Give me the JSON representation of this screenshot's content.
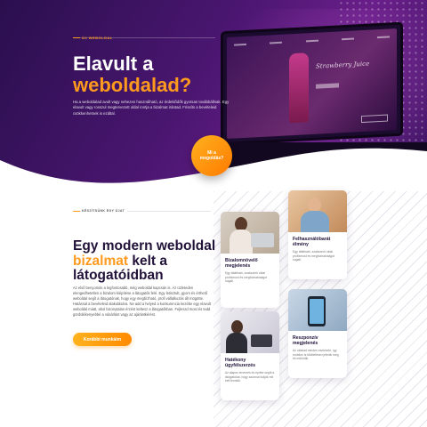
{
  "hero": {
    "eyebrow": "ÚJ WEBOLDAL",
    "title_line1": "Elavult a",
    "title_line2": "weboldalad?",
    "text": "Ha a weboldalad avult vagy nehezen használható, az érdeklődők gyorsan továbbállnak. Egy elavult vagy rosszul megtervezett oldal rontja a bizalmat irántad. Frissíts a bevételeid csökkenhetnek is ezáltal.",
    "cta": "Mi a megoldás?"
  },
  "laptop_screen": {
    "headline": "Strawberry Juice"
  },
  "section2": {
    "eyebrow": "KÉSZÍTSÜNK EGY ÚJAT",
    "title_part1": "Egy modern weboldal ",
    "title_accent": "bizalmat",
    "title_part2": " kelt a látogatóidban",
    "text": "Az első benyomás a legfontosabb, még weboldal kapcsán is. Az üzleteden elengedhetetlen a bizalom kiépítése a látogatók felé. Egy letisztult, gyors és érthető weboldal segít a látogatónak, hogy egy megbízható, profi vállalkozás áll mögötte. Hatással a bevételeid alakulására. Ne add a helyed a konkurencia kezébe egy elavult weboldal miatt, ahol bizonytalan érzést keltesz a látogatókban. Fejleszd most és tedd gördülékenyebbé a vásárlást vagy az ajánlatkérést.",
    "button": "Korábbi munkáim"
  },
  "cards": [
    {
      "title": "Bizalomnövelő megjelenés",
      "desc": "Egy átlátható, szakszerű oldal profizmust és megbízhatóságot sugall."
    },
    {
      "title": "Felhasználóbarát élmény",
      "desc": "Egy átlátható, szakszerű oldal profizmust és megbízhatóságot sugall."
    },
    {
      "title": "Hatékony ügyfélszerzés",
      "desc": "Az alapos tervezés és építés segíti a látogatókat, hogy azonnal tudják mit kell tenniük."
    },
    {
      "title": "Reszponzív megjelenés",
      "desc": "Az oldalad minden eszközön, így mobilon is tökéletesen jelenik meg és működik."
    }
  ]
}
